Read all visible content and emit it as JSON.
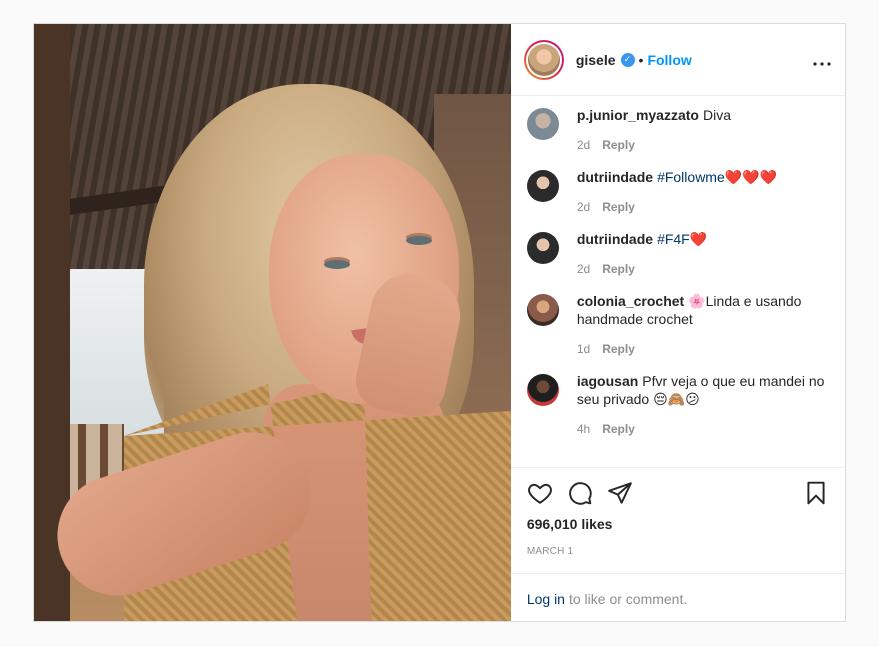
{
  "post": {
    "username": "gisele",
    "separator": "•",
    "follow_label": "Follow",
    "more_label": "•••",
    "verified_icon": "verified-badge-icon",
    "photo_alt": "selfie photo"
  },
  "comments": [
    {
      "user": "p.junior_myazzato",
      "text": "Diva",
      "hashtag": "",
      "emoji": "",
      "time": "2d",
      "reply": "Reply",
      "avatar_color": "#7c8a96"
    },
    {
      "user": "dutriindade",
      "text": "",
      "hashtag": "#Followme",
      "emoji": "❤️❤️❤️",
      "time": "2d",
      "reply": "Reply",
      "avatar_color": "#3a3a3a"
    },
    {
      "user": "dutriindade",
      "text": "",
      "hashtag": "#F4F",
      "emoji": "❤️",
      "time": "2d",
      "reply": "Reply",
      "avatar_color": "#3a3a3a"
    },
    {
      "user": "colonia_crochet",
      "text": "🌸Linda e usando handmade crochet",
      "hashtag": "",
      "emoji": "",
      "time": "1d",
      "reply": "Reply",
      "avatar_color": "#8a5a4a"
    },
    {
      "user": "iagousan",
      "text": "Pfvr veja o que eu mandei no seu privado 😔🙈😕",
      "hashtag": "",
      "emoji": "",
      "time": "4h",
      "reply": "Reply",
      "avatar_color": "#1f1f1f"
    }
  ],
  "actions": {
    "likes": "696,010 likes",
    "date": "MARCH 1",
    "like_icon": "heart-icon",
    "comment_icon": "comment-icon",
    "share_icon": "share-icon",
    "save_icon": "bookmark-icon"
  },
  "login": {
    "link": "Log in",
    "text": "to like or comment."
  }
}
